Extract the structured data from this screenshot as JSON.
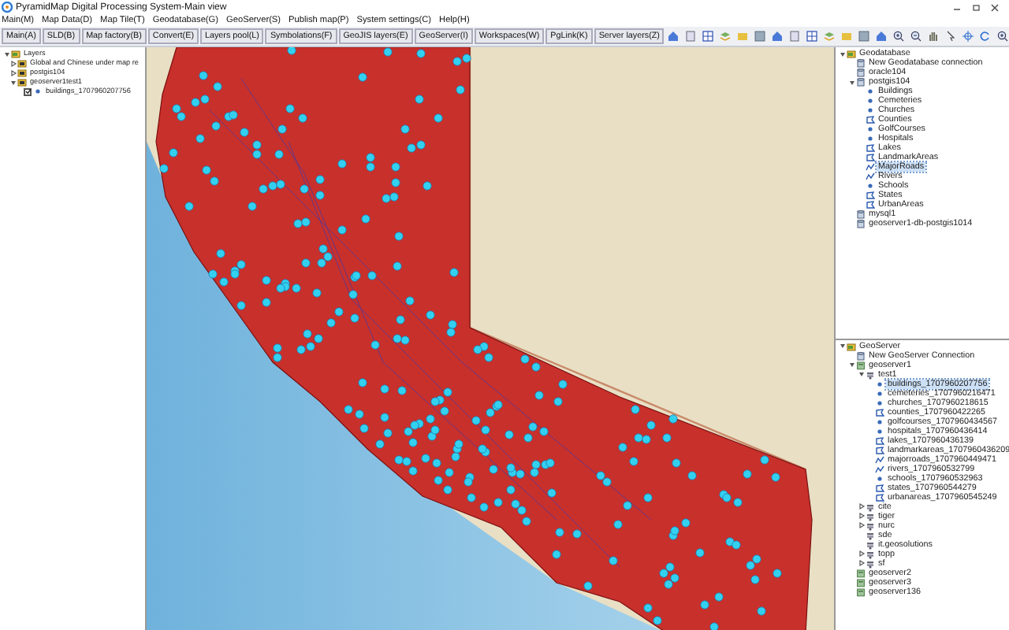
{
  "window": {
    "title": "PyramidMap Digital Processing System-Main view"
  },
  "menu": [
    "Main(M)",
    "Map Data(D)",
    "Map Tile(T)",
    "Geodatabase(G)",
    "GeoServer(S)",
    "Publish map(P)",
    "System settings(C)",
    "Help(H)"
  ],
  "toolbar": [
    "Main(A)",
    "SLD(B)",
    "Map factory(B)",
    "Convert(E)",
    "Layers pool(L)",
    "Symbolations(F)",
    "GeoJIS layers(E)",
    "GeoServer(I)",
    "Workspaces(W)",
    "PgLink(K)",
    "Server layers(Z)"
  ],
  "layers_tree": [
    {
      "label": "Layers",
      "kind": "root",
      "expanded": true,
      "children": [
        {
          "label": "Global and Chinese under map re",
          "kind": "folder",
          "expanded": false
        },
        {
          "label": "postgis104",
          "kind": "folder",
          "expanded": false
        },
        {
          "label": "geoserver1test1",
          "kind": "folder",
          "expanded": true,
          "children": [
            {
              "label": "buildings_1707960207756",
              "kind": "point",
              "checked": true
            }
          ]
        }
      ]
    }
  ],
  "geodatabase_tree": [
    {
      "label": "Geodatabase",
      "kind": "root",
      "expanded": true,
      "children": [
        {
          "label": "New Geodatabase connection",
          "kind": "db"
        },
        {
          "label": "oracle104",
          "kind": "db"
        },
        {
          "label": "postgis104",
          "kind": "db",
          "expanded": true,
          "children": [
            {
              "label": "Buildings",
              "kind": "point",
              "selected": false
            },
            {
              "label": "Cemeteries",
              "kind": "point",
              "selected": false
            },
            {
              "label": "Churches",
              "kind": "point",
              "selected": false
            },
            {
              "label": "Counties",
              "kind": "polygon",
              "selected": false
            },
            {
              "label": "GolfCourses",
              "kind": "point",
              "selected": false
            },
            {
              "label": "Hospitals",
              "kind": "point",
              "selected": false
            },
            {
              "label": "Lakes",
              "kind": "polygon",
              "selected": false
            },
            {
              "label": "LandmarkAreas",
              "kind": "polygon",
              "selected": false
            },
            {
              "label": "MajorRoads",
              "kind": "line",
              "selected": true
            },
            {
              "label": "Rivers",
              "kind": "line",
              "selected": false
            },
            {
              "label": "Schools",
              "kind": "point",
              "selected": false
            },
            {
              "label": "States",
              "kind": "polygon",
              "selected": false
            },
            {
              "label": "UrbanAreas",
              "kind": "polygon",
              "selected": false
            }
          ]
        },
        {
          "label": "mysql1",
          "kind": "db"
        },
        {
          "label": "geoserver1-db-postgis1014",
          "kind": "db"
        }
      ]
    }
  ],
  "geoserver_tree": [
    {
      "label": "GeoServer",
      "kind": "root",
      "expanded": true,
      "children": [
        {
          "label": "New GeoServer Connection",
          "kind": "db"
        },
        {
          "label": "geoserver1",
          "kind": "server",
          "expanded": true,
          "children": [
            {
              "label": "test1",
              "kind": "workspace",
              "expanded": true,
              "children": [
                {
                  "label": "buildings_1707960207756",
                  "kind": "point",
                  "selected": true
                },
                {
                  "label": "cemeteries_1707960216471",
                  "kind": "point",
                  "selected": false
                },
                {
                  "label": "churches_1707960218615",
                  "kind": "point",
                  "selected": false
                },
                {
                  "label": "counties_1707960422265",
                  "kind": "polygon",
                  "selected": false
                },
                {
                  "label": "golfcourses_1707960434567",
                  "kind": "point",
                  "selected": false
                },
                {
                  "label": "hospitals_1707960436414",
                  "kind": "point",
                  "selected": false
                },
                {
                  "label": "lakes_1707960436139",
                  "kind": "polygon",
                  "selected": false
                },
                {
                  "label": "landmarkareas_1707960436209",
                  "kind": "polygon",
                  "selected": false
                },
                {
                  "label": "majorroads_1707960449471",
                  "kind": "line",
                  "selected": false
                },
                {
                  "label": "rivers_1707960532799",
                  "kind": "line",
                  "selected": false
                },
                {
                  "label": "schools_1707960532963",
                  "kind": "point",
                  "selected": false
                },
                {
                  "label": "states_1707960544279",
                  "kind": "polygon",
                  "selected": false
                },
                {
                  "label": "urbanareas_1707960545249",
                  "kind": "polygon",
                  "selected": false
                }
              ]
            },
            {
              "label": "cite",
              "kind": "workspace",
              "expanded": false
            },
            {
              "label": "tiger",
              "kind": "workspace",
              "expanded": false
            },
            {
              "label": "nurc",
              "kind": "workspace",
              "expanded": false
            },
            {
              "label": "sde",
              "kind": "workspace"
            },
            {
              "label": "it.geosolutions",
              "kind": "workspace"
            },
            {
              "label": "topp",
              "kind": "workspace",
              "expanded": false
            },
            {
              "label": "sf",
              "kind": "workspace",
              "expanded": false
            }
          ]
        },
        {
          "label": "geoserver2",
          "kind": "server"
        },
        {
          "label": "geoserver3",
          "kind": "server"
        },
        {
          "label": "geoserver136",
          "kind": "server"
        }
      ]
    }
  ]
}
